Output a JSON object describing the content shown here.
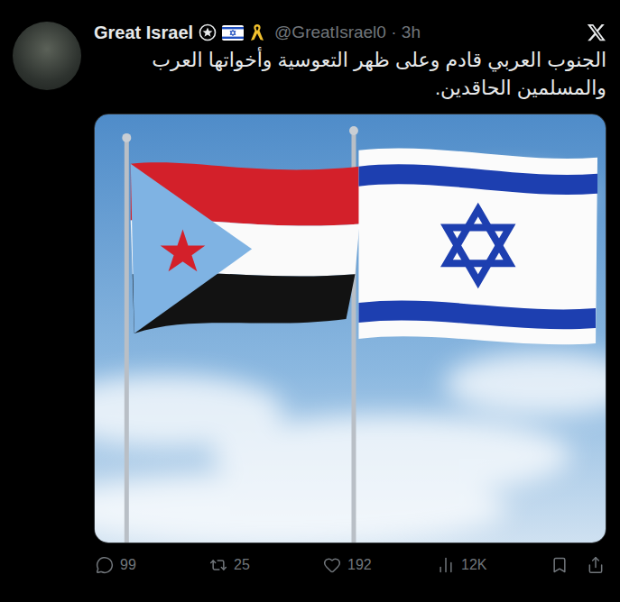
{
  "post": {
    "author": "Great Israel",
    "handle": "@GreatIsrael0",
    "separator": "·",
    "time": "3h",
    "text": "الجنوب العربي قادم وعلى ظهر التعوسية وأخواتها العرب والمسلمين الحاقدين."
  },
  "actions": [
    {
      "kind": "reply",
      "count": "99"
    },
    {
      "kind": "repost",
      "count": "25"
    },
    {
      "kind": "like",
      "count": "192"
    },
    {
      "kind": "views",
      "count": "12K"
    },
    {
      "kind": "bookmark",
      "count": ""
    },
    {
      "kind": "share",
      "count": ""
    }
  ]
}
